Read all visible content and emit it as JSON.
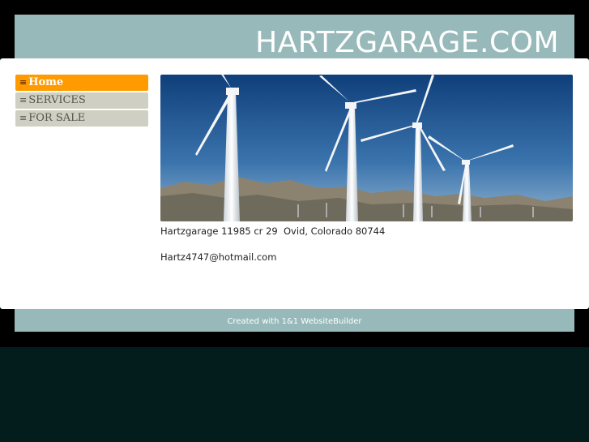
{
  "header": {
    "site_title": "HARTZGARAGE.COM"
  },
  "nav": {
    "items": [
      {
        "label": "Home",
        "active": true
      },
      {
        "label": "SERVICES",
        "active": false
      },
      {
        "label": "FOR SALE",
        "active": false
      }
    ],
    "bullet_glyph": "≡"
  },
  "main": {
    "banner_image": "wind-turbines-landscape",
    "address": "Hartzgarage 11985 cr 29  Ovid, Colorado 80744",
    "email": "Hartz4747@hotmail.com"
  },
  "footer": {
    "text": "Created with 1&1 WebsiteBuilder"
  },
  "colors": {
    "background": "#031c1c",
    "band": "#98b9b9",
    "nav_active": "#ff9a00",
    "nav_inactive": "#cfcfc3"
  }
}
